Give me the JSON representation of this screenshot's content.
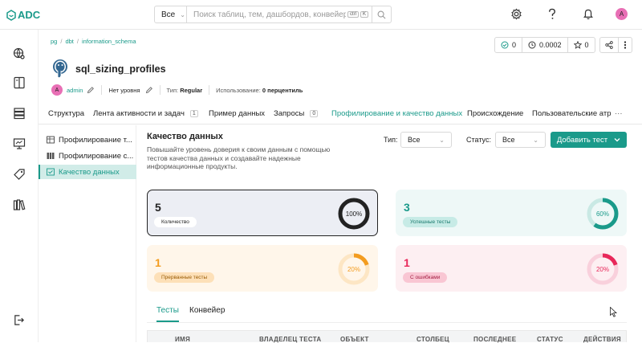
{
  "app": {
    "logo_text": "ADC"
  },
  "search": {
    "scope": "Все",
    "placeholder": "Поиск таблиц, тем, дашбордов, конвейеров, м...",
    "shortcut_ctrl": "ctrl",
    "shortcut_key": "K"
  },
  "breadcrumb": {
    "items": [
      "pg",
      "dbt",
      "information_schema"
    ]
  },
  "stats": {
    "watchers": "0",
    "usage_value": "0.0002",
    "stars": "0"
  },
  "entity": {
    "title": "sql_sizing_profiles",
    "owner_initial": "A",
    "owner": "admin",
    "tier": "Нет уровня",
    "type_label": "Тип:",
    "type_value": "Regular",
    "usage_label": "Использование:",
    "usage_value": "0 перцентиль"
  },
  "tabs": [
    {
      "label": "Структура"
    },
    {
      "label": "Лента активности и задач",
      "count": "1"
    },
    {
      "label": "Пример данных"
    },
    {
      "label": "Запросы",
      "count": "0"
    },
    {
      "label": "Профилирование и качество данных",
      "active": true
    },
    {
      "label": "Происхождение"
    },
    {
      "label": "Пользовательские атр"
    }
  ],
  "tabs_more": "···",
  "subnav": [
    {
      "label": "Профилирование т...",
      "icon": "table-icon"
    },
    {
      "label": "Профилирование с...",
      "icon": "columns-icon"
    },
    {
      "label": "Качество данных",
      "icon": "quality-icon",
      "active": true
    }
  ],
  "quality": {
    "title": "Качество данных",
    "description": "Повышайте уровень доверия к своим данным с помощью тестов качества данных и создавайте надежные информационные продукты.",
    "type_filter_label": "Тип:",
    "type_filter_value": "Все",
    "status_filter_label": "Статус:",
    "status_filter_value": "Все",
    "add_test_label": "Добавить тест"
  },
  "cards": [
    {
      "count": "5",
      "label": "Количество",
      "percent": "100%",
      "fraction": 1.0,
      "color": "#222222",
      "bg": "#eceef4",
      "border": "#222222",
      "badge_bg": "#ffffff",
      "badge_color": "#222222",
      "ring_bg": "#e5e7ee"
    },
    {
      "count": "3",
      "label": "Успешные тесты",
      "percent": "60%",
      "fraction": 0.6,
      "color": "#1a9a8a",
      "bg": "#eef8f7",
      "border": "#eef8f7",
      "badge_bg": "#c7ebe6",
      "badge_color": "#1a7a6e",
      "ring_bg": "#c9e9e4"
    },
    {
      "count": "1",
      "label": "Прерванные тесты",
      "percent": "20%",
      "fraction": 0.2,
      "color": "#f39c1f",
      "bg": "#fff6ea",
      "border": "#fff6ea",
      "badge_bg": "#fde0b8",
      "badge_color": "#9a5c05",
      "ring_bg": "#fde6c4"
    },
    {
      "count": "1",
      "label": "С ошибками",
      "percent": "20%",
      "fraction": 0.2,
      "color": "#e8285a",
      "bg": "#fdeff2",
      "border": "#fdeff2",
      "badge_bg": "#f9c6d3",
      "badge_color": "#a31d42",
      "ring_bg": "#f9d0dc"
    }
  ],
  "content_tabs": [
    {
      "label": "Тесты",
      "active": true
    },
    {
      "label": "Конвейер"
    }
  ],
  "table": {
    "columns": [
      "ИМЯ",
      "ВЛАДЕЛЕЦ ТЕСТА",
      "ОБЪЕКТ",
      "СТОЛБЕЦ",
      "ПОСЛЕДНЕЕ",
      "СТАТУС",
      "ДЕЙСТВИЯ"
    ]
  }
}
